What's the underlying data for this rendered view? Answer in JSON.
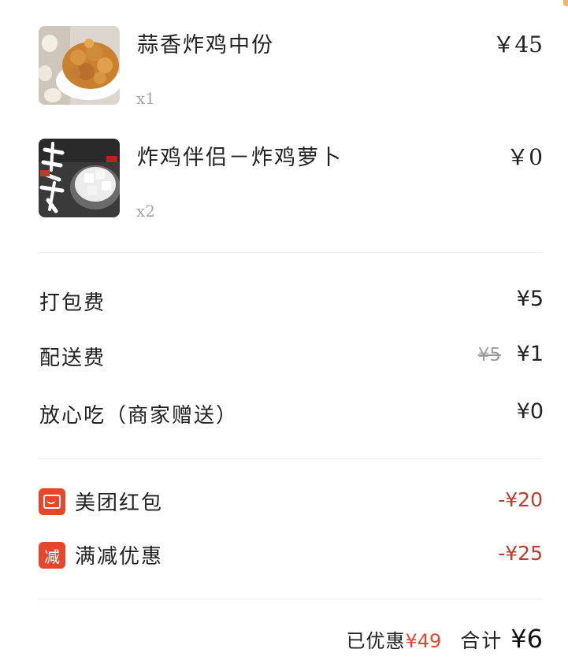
{
  "items": [
    {
      "name": "蒜香炸鸡中份",
      "qty": "x1",
      "price": "￥45"
    },
    {
      "name": "炸鸡伴侣－炸鸡萝卜",
      "qty": "x2",
      "price": "￥0"
    }
  ],
  "fees": {
    "packing": {
      "label": "打包费",
      "value": "¥5"
    },
    "delivery": {
      "label": "配送费",
      "original": "¥5",
      "value": "¥1"
    },
    "insurance": {
      "label": "放心吃（商家赠送）",
      "value": "¥0"
    }
  },
  "discounts": {
    "red_packet": {
      "label": "美团红包",
      "value": "-¥20"
    },
    "full_reduction": {
      "label": "满减优惠",
      "badge": "减",
      "value": "-¥25"
    }
  },
  "summary": {
    "saved_label": "已优惠",
    "saved_amount": "¥49",
    "total_label": "合计",
    "total_amount": "¥6"
  },
  "colors": {
    "accent_red": "#e8452d",
    "discount_text": "#c0392b",
    "muted": "#a3a3a3"
  }
}
